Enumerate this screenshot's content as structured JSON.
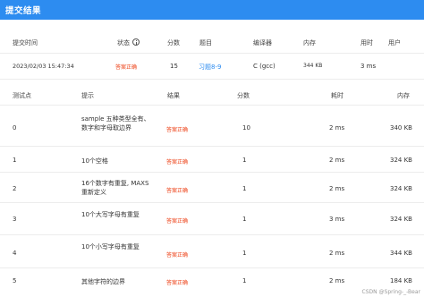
{
  "title": "提交结果",
  "summary": {
    "headers": {
      "time": "提交时间",
      "status": "状态",
      "score": "分数",
      "problem": "题目",
      "compiler": "编译器",
      "memory": "内存",
      "time_used": "用时",
      "user": "用户"
    },
    "row": {
      "time": "2023/02/03 15:47:34",
      "status": "答案正确",
      "score": "15",
      "problem": "习题8-9",
      "compiler": "C (gcc)",
      "memory": "344 KB",
      "time_used": "3 ms",
      "user": ""
    }
  },
  "tests": {
    "headers": {
      "id": "测试点",
      "hint": "提示",
      "result": "结果",
      "score": "分数",
      "time": "耗时",
      "memory": "内存"
    },
    "rows": [
      {
        "id": "0",
        "hint": "sample 五种类型全有、数字和字母取边界",
        "result": "答案正确",
        "score": "10",
        "time": "2 ms",
        "memory": "340 KB"
      },
      {
        "id": "1",
        "hint": "10个空格",
        "result": "答案正确",
        "score": "1",
        "time": "2 ms",
        "memory": "324 KB"
      },
      {
        "id": "2",
        "hint": "16个数字有重复, MAXS重新定义",
        "result": "答案正确",
        "score": "1",
        "time": "2 ms",
        "memory": "324 KB"
      },
      {
        "id": "3",
        "hint": "10个大写字母有重复",
        "result": "答案正确",
        "score": "1",
        "time": "3 ms",
        "memory": "324 KB"
      },
      {
        "id": "4",
        "hint": "10个小写字母有重复",
        "result": "答案正确",
        "score": "1",
        "time": "2 ms",
        "memory": "344 KB"
      },
      {
        "id": "5",
        "hint": "其他字符的边界",
        "result": "答案正确",
        "score": "1",
        "time": "2 ms",
        "memory": "184 KB"
      }
    ]
  },
  "watermark": "CSDN @Spring-_-Bear",
  "colors": {
    "header_bar": "#2d8cf0",
    "accepted": "#ed3f14",
    "link": "#2d8cf0"
  }
}
